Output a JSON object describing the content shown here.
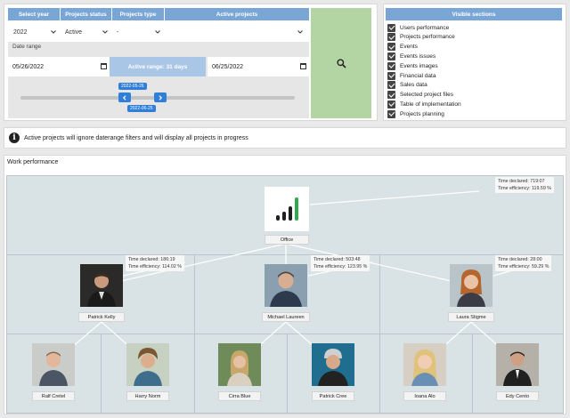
{
  "filters": {
    "headers": {
      "year": "Select year",
      "status": "Projects status",
      "type": "Projects type",
      "active": "Active projects"
    },
    "year_value": "2022",
    "status_value": "Active",
    "type_value": "-",
    "active_value": "",
    "date_range_label": "Date range",
    "date_from": "05/26/2022",
    "date_to": "06/25/2022",
    "active_range_label": "Active range: 31 days",
    "slider_top_label": "2022-05-26",
    "slider_bottom_label": "2022-06-25"
  },
  "visible_sections": {
    "title": "Visible sections",
    "items": [
      "Users performance",
      "Projects performance",
      "Events",
      "Events issues",
      "Events images",
      "Financial data",
      "Sales data",
      "Selected project files",
      "Table of implementation",
      "Projects planning"
    ]
  },
  "info": {
    "text": "Active projects will ignore daterange filters and will display all projects in progress"
  },
  "work_performance": {
    "title": "Work performance",
    "root": {
      "label": "Office",
      "time_declared": "Time declared: 719:07",
      "time_efficiency": "Time efficiency: 119.59 %"
    },
    "managers": [
      {
        "name": "Patrick Kelly",
        "time_declared": "Time declared: 186:19",
        "time_efficiency": "Time efficiency: 114.02 %"
      },
      {
        "name": "Michael Laureen",
        "time_declared": "Time declared: 503:48",
        "time_efficiency": "Time efficiency: 123.95 %"
      },
      {
        "name": "Laura Stigme",
        "time_declared": "Time declared: 28:00",
        "time_efficiency": "Time efficiency: 59.29 %"
      }
    ],
    "members": [
      {
        "name": "Ralf Cretel"
      },
      {
        "name": "Harry Norm"
      },
      {
        "name": "Cirra Blue"
      },
      {
        "name": "Patrick Cree"
      },
      {
        "name": "Ioana Alo"
      },
      {
        "name": "Edy Cento"
      }
    ]
  },
  "colors": {
    "header_blue": "#7aa6d6",
    "search_green": "#b3d4a3",
    "active_range_blue": "#a9c6e6",
    "slider_button": "#2f7fd8",
    "chart_bg": "#d9e3e5"
  }
}
